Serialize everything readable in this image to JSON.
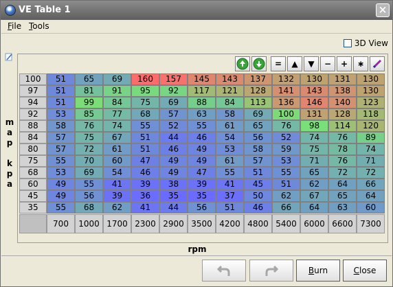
{
  "window": {
    "title": "VE Table 1"
  },
  "menu": [
    {
      "label": "File",
      "underline": "F",
      "rest": "ile"
    },
    {
      "label": "Tools",
      "underline": "T",
      "rest": "ools"
    }
  ],
  "view_3d": {
    "label": "3D View",
    "checked": false
  },
  "toolbar": [
    {
      "name": "increase-green-icon",
      "glyph": ""
    },
    {
      "name": "decrease-green-icon",
      "glyph": ""
    },
    {
      "name": "set-equal-button",
      "glyph": "="
    },
    {
      "name": "increment-up-button",
      "glyph": "▲"
    },
    {
      "name": "decrement-down-button",
      "glyph": "▼"
    },
    {
      "name": "subtract-button",
      "glyph": "−"
    },
    {
      "name": "add-button",
      "glyph": "+"
    },
    {
      "name": "multiply-button",
      "glyph": "∗"
    },
    {
      "name": "interpolate-pen-button",
      "glyph": ""
    }
  ],
  "y_axis": {
    "label": [
      "m",
      "a",
      "p",
      "",
      "k",
      "p",
      "a"
    ],
    "values": [
      "100",
      "97",
      "94",
      "92",
      "88",
      "84",
      "80",
      "75",
      "68",
      "60",
      "45",
      "35"
    ]
  },
  "x_axis": {
    "label": "rpm",
    "values": [
      "700",
      "1000",
      "1700",
      "2300",
      "2900",
      "3500",
      "4200",
      "4800",
      "5400",
      "6000",
      "6600",
      "7300"
    ]
  },
  "table": [
    [
      "51",
      "65",
      "69",
      "160",
      "157",
      "145",
      "143",
      "137",
      "132",
      "130",
      "131",
      "130"
    ],
    [
      "51",
      "81",
      "91",
      "95",
      "92",
      "117",
      "121",
      "128",
      "141",
      "143",
      "138",
      "130"
    ],
    [
      "51",
      "99",
      "84",
      "75",
      "69",
      "88",
      "84",
      "113",
      "136",
      "146",
      "140",
      "123"
    ],
    [
      "53",
      "85",
      "77",
      "68",
      "57",
      "63",
      "58",
      "69",
      "100",
      "131",
      "128",
      "118"
    ],
    [
      "58",
      "76",
      "74",
      "55",
      "52",
      "55",
      "61",
      "65",
      "76",
      "98",
      "114",
      "120"
    ],
    [
      "57",
      "75",
      "67",
      "51",
      "44",
      "46",
      "54",
      "56",
      "52",
      "74",
      "76",
      "89"
    ],
    [
      "57",
      "72",
      "61",
      "51",
      "46",
      "49",
      "53",
      "58",
      "59",
      "75",
      "78",
      "74"
    ],
    [
      "55",
      "70",
      "60",
      "47",
      "49",
      "49",
      "61",
      "57",
      "53",
      "71",
      "76",
      "71"
    ],
    [
      "53",
      "69",
      "54",
      "46",
      "49",
      "47",
      "55",
      "51",
      "55",
      "65",
      "72",
      "72"
    ],
    [
      "49",
      "55",
      "41",
      "39",
      "38",
      "39",
      "41",
      "45",
      "51",
      "62",
      "64",
      "66"
    ],
    [
      "49",
      "56",
      "39",
      "36",
      "35",
      "35",
      "37",
      "50",
      "62",
      "67",
      "65",
      "64"
    ],
    [
      "55",
      "68",
      "62",
      "41",
      "44",
      "56",
      "51",
      "46",
      "66",
      "64",
      "63",
      "60"
    ]
  ],
  "buttons": {
    "undo": "",
    "redo": "",
    "burn": {
      "underline": "B",
      "rest": "urn"
    },
    "close": {
      "underline": "C",
      "rest": "lose"
    }
  },
  "colors": {
    "low": "#6b6bff",
    "mid": "#78e078",
    "high": "#ff6b6b"
  }
}
